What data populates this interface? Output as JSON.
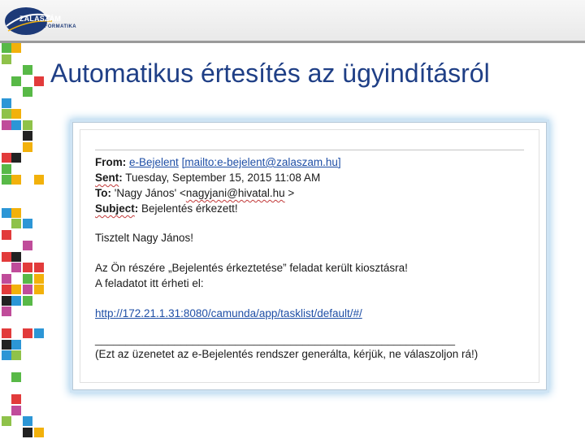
{
  "logo": {
    "name": "ZALASZÁM",
    "sub": "INFORMATIKA"
  },
  "title": "Automatikus értesítés az ügyindításról",
  "email": {
    "from_label": "From",
    "from_name": "e-Bejelent",
    "from_link": "[mailto:e-bejelent@zalaszam.hu]",
    "sent_label": "Sent",
    "sent_value": "Tuesday, September 15, 2015 11:08 AM",
    "to_label": "To",
    "to_name": "'Nagy János' <",
    "to_email": "nagyjani@hivatal.hu",
    "to_end": " >",
    "subject_label": "Subject",
    "subject_value": "Bejelentés érkezett!",
    "greeting": "Tisztelt Nagy János!",
    "body_line1": "Az Ön részére „Bejelentés érkeztetése” feladat került kiosztásra!",
    "body_line2": "A feladatot itt érheti el:",
    "task_link": "http://172.21.1.31:8080/camunda/app/tasklist/default/#/",
    "separator": "___________________________________________________________",
    "footer": "(Ezt az üzenetet az e-Bejelentés rendszer generálta, kérjük, ne válaszoljon rá!)"
  },
  "colors": {
    "title": "#1f3f86",
    "link": "#1f4fa6",
    "mosaic": [
      "#e23b3b",
      "#f2b10b",
      "#2c96d6",
      "#58b947",
      "#222222",
      "#c04c9a",
      "#8fc24a"
    ]
  }
}
